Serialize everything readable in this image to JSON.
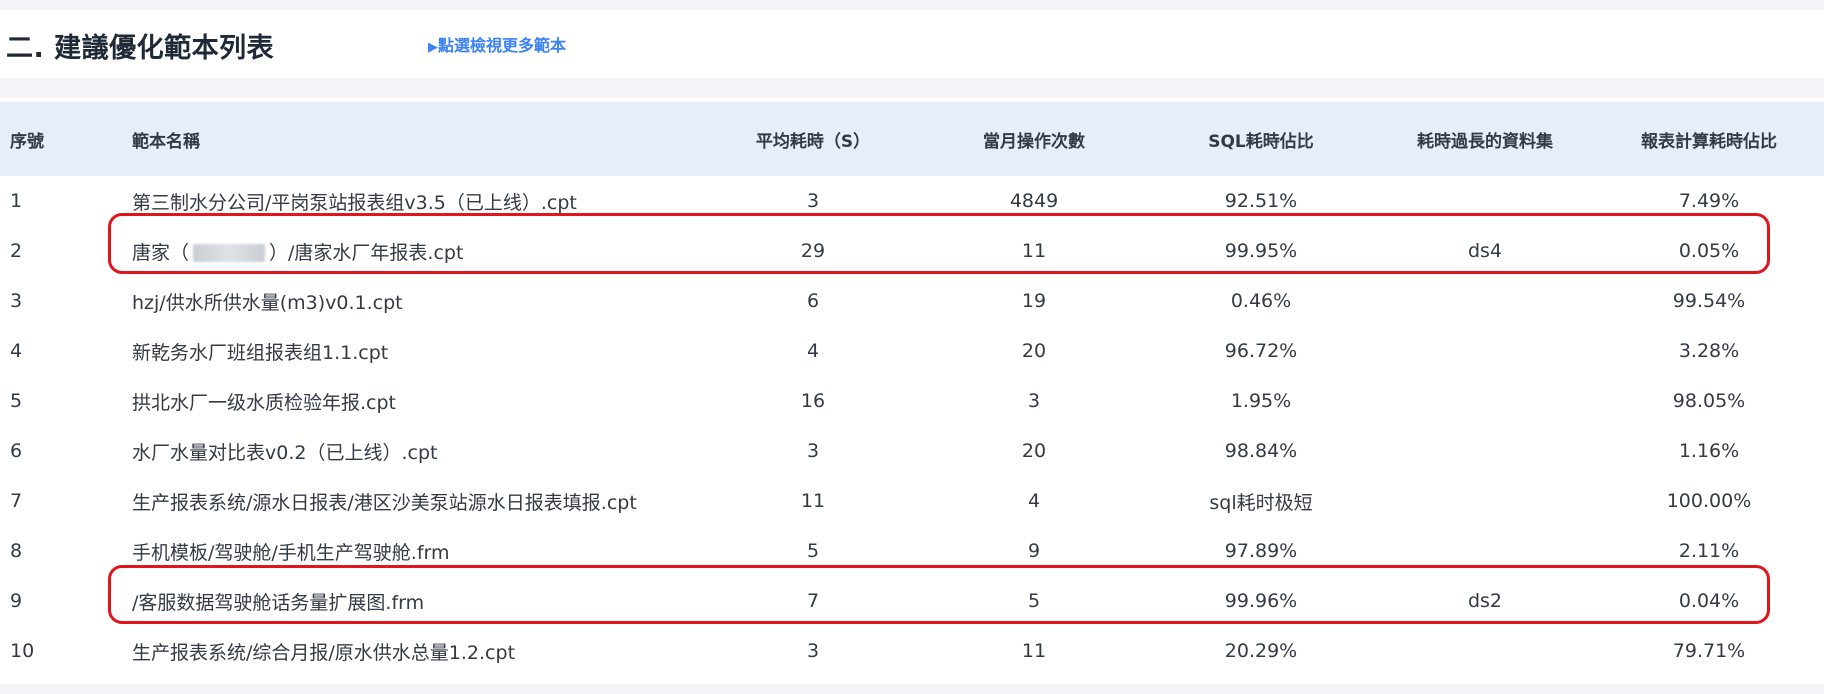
{
  "header": {
    "title": "二. 建議優化範本列表",
    "more_link_label": "點選檢視更多範本",
    "more_link_icon": "triangle-right-icon"
  },
  "table": {
    "columns": [
      "序號",
      "範本名稱",
      "平均耗時（S）",
      "當月操作次數",
      "SQL耗時佔比",
      "耗時過長的資料集",
      "報表計算耗時佔比"
    ],
    "rows": [
      {
        "idx": "1",
        "name": "第三制水分公司/平岗泵站报表组v3.5（已上线）.cpt",
        "avg": "3",
        "count": "4849",
        "sql": "92.51%",
        "ds": "",
        "calc": "7.49%"
      },
      {
        "idx": "2",
        "name_pre": "唐家（",
        "name_post": "）/唐家水厂年报表.cpt",
        "avg": "29",
        "count": "11",
        "sql": "99.95%",
        "ds": "ds4",
        "calc": "0.05%"
      },
      {
        "idx": "3",
        "name": "hzj/供水所供水量(m3)v0.1.cpt",
        "avg": "6",
        "count": "19",
        "sql": "0.46%",
        "ds": "",
        "calc": "99.54%"
      },
      {
        "idx": "4",
        "name": "新乾务水厂班组报表组1.1.cpt",
        "avg": "4",
        "count": "20",
        "sql": "96.72%",
        "ds": "",
        "calc": "3.28%"
      },
      {
        "idx": "5",
        "name": "拱北水厂一级水质检验年报.cpt",
        "avg": "16",
        "count": "3",
        "sql": "1.95%",
        "ds": "",
        "calc": "98.05%"
      },
      {
        "idx": "6",
        "name": "水厂水量对比表v0.2（已上线）.cpt",
        "avg": "3",
        "count": "20",
        "sql": "98.84%",
        "ds": "",
        "calc": "1.16%"
      },
      {
        "idx": "7",
        "name": "生产报表系统/源水日报表/港区沙美泵站源水日报表填报.cpt",
        "avg": "11",
        "count": "4",
        "sql": "sql耗时极短",
        "ds": "",
        "calc": "100.00%"
      },
      {
        "idx": "8",
        "name": "手机模板/驾驶舱/手机生产驾驶舱.frm",
        "avg": "5",
        "count": "9",
        "sql": "97.89%",
        "ds": "",
        "calc": "2.11%"
      },
      {
        "idx": "9",
        "name": "/客服数据驾驶舱话务量扩展图.frm",
        "avg": "7",
        "count": "5",
        "sql": "99.96%",
        "ds": "ds2",
        "calc": "0.04%"
      },
      {
        "idx": "10",
        "name": "生产报表系统/综合月报/原水供水总量1.2.cpt",
        "avg": "3",
        "count": "11",
        "sql": "20.29%",
        "ds": "",
        "calc": "79.71%"
      }
    ]
  },
  "colors": {
    "header_bg": "#e6eefc",
    "link": "#3b82f6",
    "highlight": "#e0161d",
    "text": "#333a45"
  }
}
